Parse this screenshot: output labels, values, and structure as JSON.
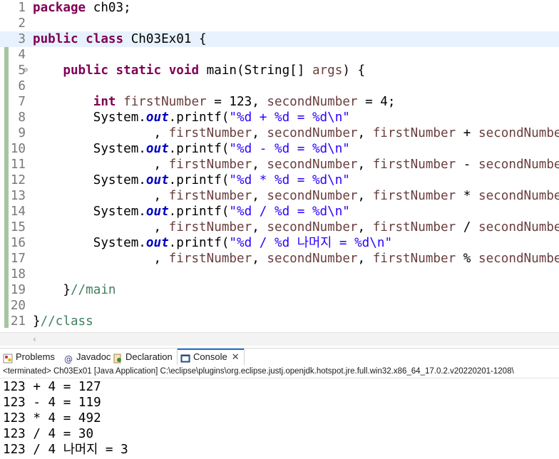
{
  "editor": {
    "lines": [
      {
        "num": "1",
        "tokens": [
          {
            "t": "kw",
            "v": "package"
          },
          {
            "t": "plain",
            "v": " ch03;"
          }
        ]
      },
      {
        "num": "2",
        "tokens": []
      },
      {
        "num": "3",
        "current": true,
        "tokens": [
          {
            "t": "kw",
            "v": "public"
          },
          {
            "t": "plain",
            "v": " "
          },
          {
            "t": "kw",
            "v": "class"
          },
          {
            "t": "plain",
            "v": " Ch03Ex01 {"
          }
        ]
      },
      {
        "num": "4",
        "tokens": []
      },
      {
        "num": "5",
        "fold": "⊖",
        "tokens": [
          {
            "t": "plain",
            "v": "    "
          },
          {
            "t": "kw",
            "v": "public"
          },
          {
            "t": "plain",
            "v": " "
          },
          {
            "t": "kw",
            "v": "static"
          },
          {
            "t": "plain",
            "v": " "
          },
          {
            "t": "kw",
            "v": "void"
          },
          {
            "t": "plain",
            "v": " main(String[] "
          },
          {
            "t": "var",
            "v": "args"
          },
          {
            "t": "plain",
            "v": ") {"
          }
        ]
      },
      {
        "num": "6",
        "tokens": []
      },
      {
        "num": "7",
        "tokens": [
          {
            "t": "plain",
            "v": "        "
          },
          {
            "t": "kw",
            "v": "int"
          },
          {
            "t": "plain",
            "v": " "
          },
          {
            "t": "var",
            "v": "firstNumber"
          },
          {
            "t": "plain",
            "v": " = 123, "
          },
          {
            "t": "var",
            "v": "secondNumber"
          },
          {
            "t": "plain",
            "v": " = 4;"
          }
        ]
      },
      {
        "num": "8",
        "tokens": [
          {
            "t": "plain",
            "v": "        System."
          },
          {
            "t": "static",
            "v": "out"
          },
          {
            "t": "plain",
            "v": ".printf("
          },
          {
            "t": "str",
            "v": "\"%d + %d = %d\\n\""
          }
        ]
      },
      {
        "num": "9",
        "tokens": [
          {
            "t": "plain",
            "v": "                , "
          },
          {
            "t": "var",
            "v": "firstNumber"
          },
          {
            "t": "plain",
            "v": ", "
          },
          {
            "t": "var",
            "v": "secondNumber"
          },
          {
            "t": "plain",
            "v": ", "
          },
          {
            "t": "var",
            "v": "firstNumber"
          },
          {
            "t": "plain",
            "v": " + "
          },
          {
            "t": "var",
            "v": "secondNumber"
          },
          {
            "t": "plain",
            "v": ");"
          }
        ]
      },
      {
        "num": "10",
        "tokens": [
          {
            "t": "plain",
            "v": "        System."
          },
          {
            "t": "static",
            "v": "out"
          },
          {
            "t": "plain",
            "v": ".printf("
          },
          {
            "t": "str",
            "v": "\"%d - %d = %d\\n\""
          }
        ]
      },
      {
        "num": "11",
        "tokens": [
          {
            "t": "plain",
            "v": "                , "
          },
          {
            "t": "var",
            "v": "firstNumber"
          },
          {
            "t": "plain",
            "v": ", "
          },
          {
            "t": "var",
            "v": "secondNumber"
          },
          {
            "t": "plain",
            "v": ", "
          },
          {
            "t": "var",
            "v": "firstNumber"
          },
          {
            "t": "plain",
            "v": " - "
          },
          {
            "t": "var",
            "v": "secondNumber"
          },
          {
            "t": "plain",
            "v": ");"
          }
        ]
      },
      {
        "num": "12",
        "tokens": [
          {
            "t": "plain",
            "v": "        System."
          },
          {
            "t": "static",
            "v": "out"
          },
          {
            "t": "plain",
            "v": ".printf("
          },
          {
            "t": "str",
            "v": "\"%d * %d = %d\\n\""
          }
        ]
      },
      {
        "num": "13",
        "tokens": [
          {
            "t": "plain",
            "v": "                , "
          },
          {
            "t": "var",
            "v": "firstNumber"
          },
          {
            "t": "plain",
            "v": ", "
          },
          {
            "t": "var",
            "v": "secondNumber"
          },
          {
            "t": "plain",
            "v": ", "
          },
          {
            "t": "var",
            "v": "firstNumber"
          },
          {
            "t": "plain",
            "v": " * "
          },
          {
            "t": "var",
            "v": "secondNumber"
          },
          {
            "t": "plain",
            "v": ");"
          }
        ]
      },
      {
        "num": "14",
        "tokens": [
          {
            "t": "plain",
            "v": "        System."
          },
          {
            "t": "static",
            "v": "out"
          },
          {
            "t": "plain",
            "v": ".printf("
          },
          {
            "t": "str",
            "v": "\"%d / %d = %d\\n\""
          }
        ]
      },
      {
        "num": "15",
        "tokens": [
          {
            "t": "plain",
            "v": "                , "
          },
          {
            "t": "var",
            "v": "firstNumber"
          },
          {
            "t": "plain",
            "v": ", "
          },
          {
            "t": "var",
            "v": "secondNumber"
          },
          {
            "t": "plain",
            "v": ", "
          },
          {
            "t": "var",
            "v": "firstNumber"
          },
          {
            "t": "plain",
            "v": " / "
          },
          {
            "t": "var",
            "v": "secondNumber"
          },
          {
            "t": "plain",
            "v": ");"
          }
        ]
      },
      {
        "num": "16",
        "tokens": [
          {
            "t": "plain",
            "v": "        System."
          },
          {
            "t": "static",
            "v": "out"
          },
          {
            "t": "plain",
            "v": ".printf("
          },
          {
            "t": "str",
            "v": "\"%d / %d 나머지 = %d\\n\""
          }
        ]
      },
      {
        "num": "17",
        "tokens": [
          {
            "t": "plain",
            "v": "                , "
          },
          {
            "t": "var",
            "v": "firstNumber"
          },
          {
            "t": "plain",
            "v": ", "
          },
          {
            "t": "var",
            "v": "secondNumber"
          },
          {
            "t": "plain",
            "v": ", "
          },
          {
            "t": "var",
            "v": "firstNumber"
          },
          {
            "t": "plain",
            "v": " % "
          },
          {
            "t": "var",
            "v": "secondNumber"
          },
          {
            "t": "plain",
            "v": ");"
          }
        ]
      },
      {
        "num": "18",
        "tokens": []
      },
      {
        "num": "19",
        "tokens": [
          {
            "t": "plain",
            "v": "    }"
          },
          {
            "t": "comment",
            "v": "//main"
          }
        ]
      },
      {
        "num": "20",
        "tokens": []
      },
      {
        "num": "21",
        "tokens": [
          {
            "t": "plain",
            "v": "}"
          },
          {
            "t": "comment",
            "v": "//class"
          }
        ]
      }
    ]
  },
  "panel": {
    "tabs": [
      {
        "label": "Problems",
        "icon": "problems-icon",
        "active": false
      },
      {
        "label": "Javadoc",
        "icon": "javadoc-icon",
        "active": false
      },
      {
        "label": "Declaration",
        "icon": "declaration-icon",
        "active": false
      },
      {
        "label": "Console",
        "icon": "console-icon",
        "active": true,
        "close": "✕"
      }
    ],
    "status": "<terminated> Ch03Ex01 [Java Application] C:\\eclipse\\plugins\\org.eclipse.justj.openjdk.hotspot.jre.full.win32.x86_64_17.0.2.v20220201-1208\\",
    "output": [
      "123 + 4 = 127",
      "123 - 4 = 119",
      "123 * 4 = 492",
      "123 / 4 = 30",
      "123 / 4 나머지 = 3"
    ]
  },
  "colors": {
    "keyword": "#7f0055",
    "variable": "#6a3e3e",
    "string": "#2a00ff",
    "static_field": "#0000c0",
    "comment": "#3f7f5f",
    "current_line": "#e8f2fe",
    "active_tab_accent": "#1a73e8"
  },
  "icons": {
    "scroll_left": "‹"
  }
}
